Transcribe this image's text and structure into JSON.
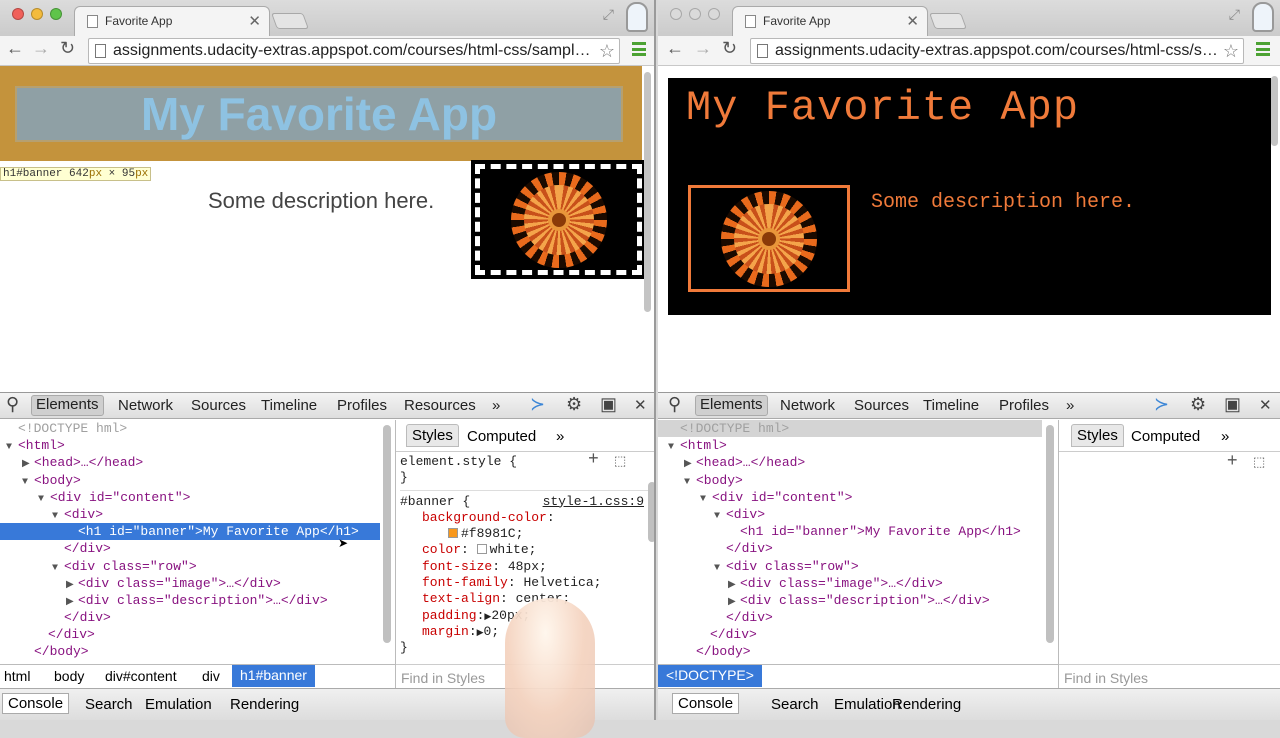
{
  "left": {
    "tab_title": "Favorite App",
    "url": "assignments.udacity-extras.appspot.com/courses/html-css/sampl…",
    "banner_text": "My Favorite App",
    "highlight_tip": {
      "tag": "h1#banner",
      "width": "642",
      "height": "95",
      "unit": "px",
      "times": "×"
    },
    "description": "Some description here.",
    "devtools": {
      "tabs": [
        "Elements",
        "Network",
        "Sources",
        "Timeline",
        "Profiles",
        "Resources"
      ],
      "more": "»",
      "dom": [
        {
          "t": "<!DOCTYPE hml>"
        },
        {
          "t": "<html>"
        },
        {
          "t": "<head>…</head>"
        },
        {
          "t": "<body>"
        },
        {
          "t": "<div id=\"content\">"
        },
        {
          "t": "<div>"
        },
        {
          "t": "<h1 id=\"banner\">My Favorite App</h1>"
        },
        {
          "t": "</div>"
        },
        {
          "t": "<div class=\"row\">"
        },
        {
          "t": "<div class=\"image\">…</div>"
        },
        {
          "t": "<div class=\"description\">…</div>"
        },
        {
          "t": "</div>"
        },
        {
          "t": "</div>"
        },
        {
          "t": "</body>"
        }
      ],
      "styles_tabs": [
        "Styles",
        "Computed",
        "»"
      ],
      "rules": {
        "element_style": "element.style {",
        "close": "}",
        "selector": "#banner {",
        "source": "style-1.css:9",
        "props": [
          {
            "name": "background-color",
            "value": ""
          },
          {
            "name": "",
            "value": "#f8981C;"
          },
          {
            "name": "color",
            "value": "white;"
          },
          {
            "name": "font-size",
            "value": "48px;"
          },
          {
            "name": "font-family",
            "value": "Helvetica;"
          },
          {
            "name": "text-align",
            "value": "center;"
          },
          {
            "name": "padding",
            "value": "20px;"
          },
          {
            "name": "margin",
            "value": "0;"
          }
        ]
      },
      "breadcrumbs": [
        "html",
        "body",
        "div#content",
        "div",
        "h1#banner"
      ],
      "find_placeholder": "Find in Styles",
      "drawer": [
        "Console",
        "Search",
        "Emulation",
        "Rendering"
      ]
    }
  },
  "right": {
    "tab_title": "Favorite App",
    "url": "assignments.udacity-extras.appspot.com/courses/html-css/s…",
    "banner_text": "My Favorite App",
    "description": "Some description here.",
    "devtools": {
      "tabs": [
        "Elements",
        "Network",
        "Sources",
        "Timeline",
        "Profiles"
      ],
      "more": "»",
      "dom": [
        {
          "t": "<!DOCTYPE hml>"
        },
        {
          "t": "<html>"
        },
        {
          "t": "<head>…</head>"
        },
        {
          "t": "<body>"
        },
        {
          "t": "<div id=\"content\">"
        },
        {
          "t": "<div>"
        },
        {
          "t": "<h1 id=\"banner\">My Favorite App</h1>"
        },
        {
          "t": "</div>"
        },
        {
          "t": "<div class=\"row\">"
        },
        {
          "t": "<div class=\"image\">…</div>"
        },
        {
          "t": "<div class=\"description\">…</div>"
        },
        {
          "t": "</div>"
        },
        {
          "t": "</div>"
        },
        {
          "t": "</body>"
        }
      ],
      "styles_tabs": [
        "Styles",
        "Computed",
        "»"
      ],
      "breadcrumb": "<!DOCTYPE>",
      "find_placeholder": "Find in Styles",
      "drawer": [
        "Console",
        "Search",
        "Emulation",
        "Rendering"
      ]
    }
  },
  "glyphs": {
    "back": "←",
    "forward": "→",
    "reload": "↻",
    "close": "✕",
    "star": "☆",
    "plus": "+",
    "gear": "⚙",
    "search": "⚲",
    "dock": "▣",
    "fullscreen": "⤢"
  },
  "colors": {
    "selection": "#3879d9",
    "banner_bg_rule": "#f8981C",
    "right_accent": "#f07a3a"
  }
}
